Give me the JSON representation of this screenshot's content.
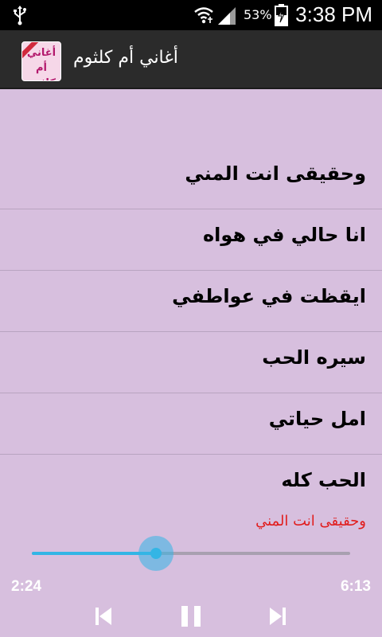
{
  "status_bar": {
    "battery_percent": "53%",
    "clock": "3:38 PM",
    "icons": [
      "usb-icon",
      "wifi-icon",
      "signal-icon",
      "battery-charging-icon"
    ]
  },
  "action_bar": {
    "title": "أغاني أم كلثوم",
    "logo_text_line1": "أغاني",
    "logo_text_line2": "أم كلثوم"
  },
  "songs": [
    {
      "title": "وحقيقى انت المني"
    },
    {
      "title": "انا حالي في هواه"
    },
    {
      "title": "ايقظت في عواطفي"
    },
    {
      "title": "سيره الحب"
    },
    {
      "title": "امل حياتي"
    },
    {
      "title": "الحب كله"
    }
  ],
  "player": {
    "now_playing": "وحقيقى انت المني",
    "elapsed": "2:24",
    "total": "6:13",
    "progress_fraction": 0.39,
    "accent_color": "#33b5e5",
    "now_playing_color": "#e11d1d",
    "controls": [
      "previous-icon",
      "pause-icon",
      "next-icon"
    ]
  }
}
